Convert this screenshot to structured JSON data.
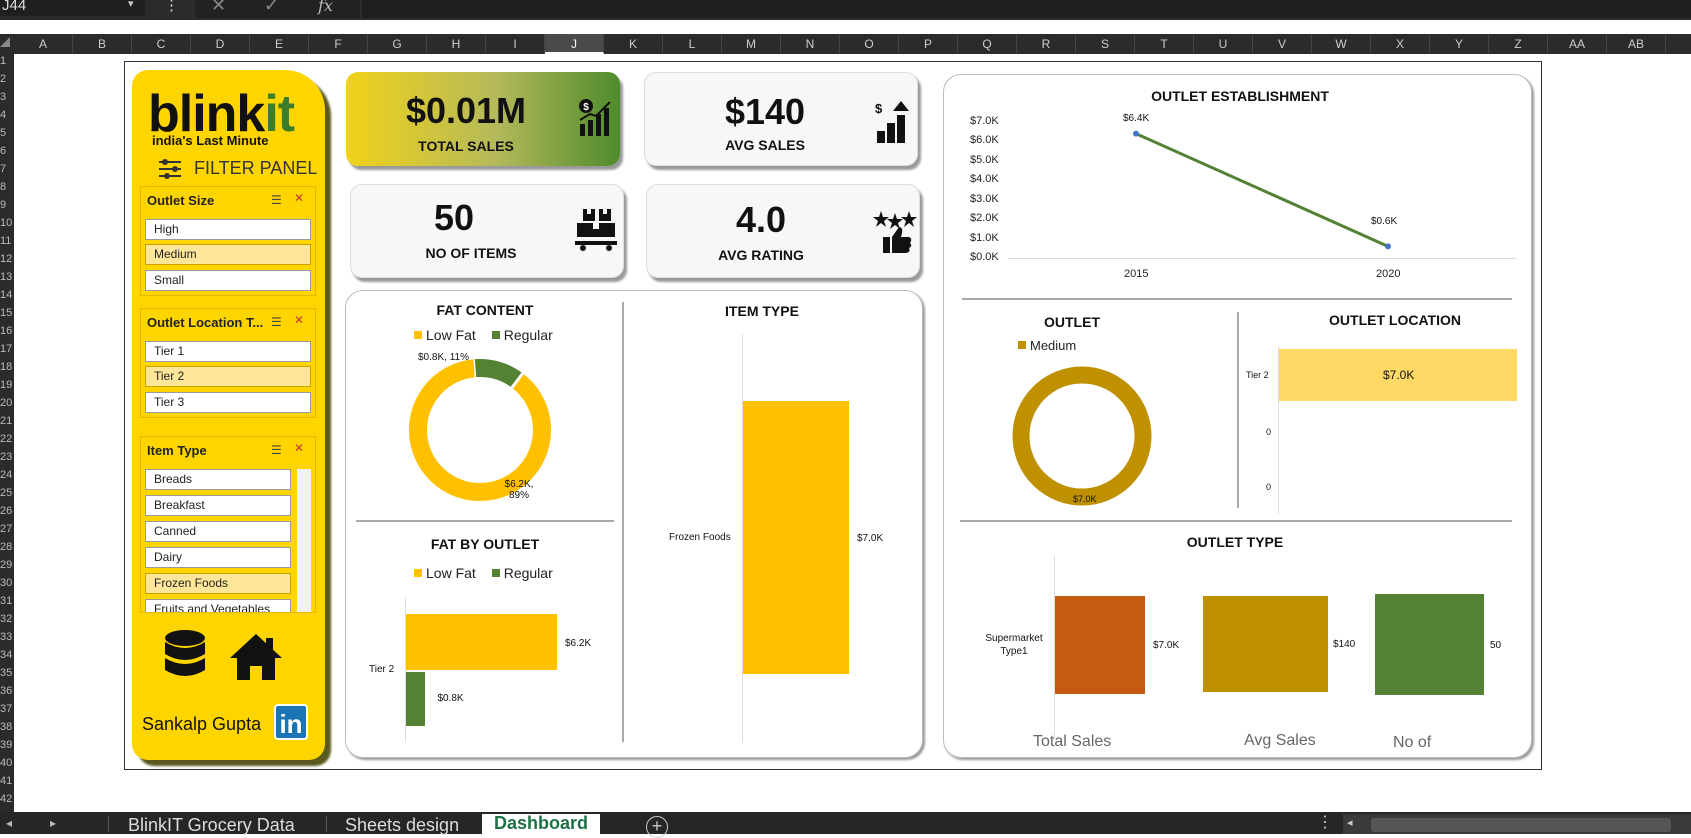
{
  "excel": {
    "name_box": "J44",
    "fx_label": "fx",
    "columns": [
      "A",
      "B",
      "C",
      "D",
      "E",
      "F",
      "G",
      "H",
      "I",
      "J",
      "K",
      "L",
      "M",
      "N",
      "O",
      "P",
      "Q",
      "R",
      "S",
      "T",
      "U",
      "V",
      "W",
      "X",
      "Y",
      "Z",
      "AA",
      "AB"
    ],
    "selected_column": "J",
    "rows": [
      "1",
      "2",
      "3",
      "4",
      "5",
      "6",
      "7",
      "8",
      "9",
      "10",
      "11",
      "12",
      "13",
      "14",
      "15",
      "16",
      "17",
      "18",
      "19",
      "20",
      "21",
      "22",
      "23",
      "24",
      "25",
      "26",
      "27",
      "28",
      "29",
      "30",
      "31",
      "32",
      "33",
      "34",
      "35",
      "36",
      "37",
      "38",
      "39",
      "40",
      "41",
      "42"
    ],
    "sheet_tabs": [
      "BlinkIT Grocery Data",
      "Sheets design",
      "Dashboard"
    ],
    "active_tab": "Dashboard"
  },
  "sidebar": {
    "logo_text": "blink",
    "logo_accent": "it",
    "tagline": "india's Last Minute",
    "filter_title": "FILTER PANEL",
    "author": "Sankalp Gupta",
    "linkedin": "in",
    "slicers": [
      {
        "title": "Outlet Size",
        "items": [
          "High",
          "Medium",
          "Small"
        ],
        "selected": "Medium"
      },
      {
        "title": "Outlet Location T...",
        "items": [
          "Tier 1",
          "Tier 2",
          "Tier 3"
        ],
        "selected": "Tier 2"
      },
      {
        "title": "Item Type",
        "items": [
          "Breads",
          "Breakfast",
          "Canned",
          "Dairy",
          "Frozen Foods",
          "Fruits and Vegetables"
        ],
        "selected": "Frozen Foods"
      }
    ]
  },
  "kpis": {
    "total_sales": {
      "value": "$0.01M",
      "label": "TOTAL SALES"
    },
    "avg_sales": {
      "value": "$140",
      "label": "AVG SALES"
    },
    "no_of_items": {
      "value": "50",
      "label": "NO OF ITEMS"
    },
    "avg_rating": {
      "value": "4.0",
      "label": "AVG RATING"
    }
  },
  "colors": {
    "yellow": "#ffc000",
    "green": "#548235",
    "olive": "#bf9000",
    "orange": "#c55a11",
    "light_yellow": "#ffd966"
  },
  "chart_data": [
    {
      "type": "pie",
      "title": "FAT CONTENT",
      "categories": [
        "Low Fat",
        "Regular"
      ],
      "values": [
        6.2,
        0.8
      ],
      "data_labels": [
        "$6.2K, 89%",
        "$0.8K, 11%"
      ]
    },
    {
      "type": "bar",
      "title": "FAT BY OUTLET",
      "categories": [
        "Tier 2"
      ],
      "series": [
        {
          "name": "Low Fat",
          "values": [
            6.2
          ]
        },
        {
          "name": "Regular",
          "values": [
            0.8
          ]
        }
      ],
      "data_labels": [
        "$6.2K",
        "$0.8K"
      ]
    },
    {
      "type": "bar",
      "title": "ITEM TYPE",
      "categories": [
        "Frozen Foods"
      ],
      "values": [
        7.0
      ],
      "data_labels": [
        "$7.0K"
      ]
    },
    {
      "type": "line",
      "title": "OUTLET ESTABLISHMENT",
      "x": [
        "2015",
        "2020"
      ],
      "values": [
        6.4,
        0.6
      ],
      "data_labels": [
        "$6.4K",
        "$0.6K"
      ],
      "yticks": [
        "$7.0K",
        "$6.0K",
        "$5.0K",
        "$4.0K",
        "$3.0K",
        "$2.0K",
        "$1.0K",
        "$0.0K"
      ],
      "ylim": [
        0,
        7
      ]
    },
    {
      "type": "pie",
      "title": "OUTLET",
      "categories": [
        "Medium"
      ],
      "values": [
        7.0
      ],
      "data_labels": [
        "$7.0K"
      ]
    },
    {
      "type": "bar",
      "title": "OUTLET LOCATION",
      "categories": [
        "Tier 2",
        "0",
        "0"
      ],
      "values": [
        7.0
      ],
      "data_labels": [
        "$7.0K"
      ]
    },
    {
      "type": "bar",
      "title": "OUTLET TYPE",
      "categories": [
        "Supermarket Type1"
      ],
      "series": [
        {
          "name": "Total Sales",
          "values": [
            7.0
          ],
          "label": "$7.0K"
        },
        {
          "name": "Avg Sales",
          "values": [
            140
          ],
          "label": "$140"
        },
        {
          "name": "No of",
          "values": [
            50
          ],
          "label": "50"
        }
      ]
    }
  ]
}
